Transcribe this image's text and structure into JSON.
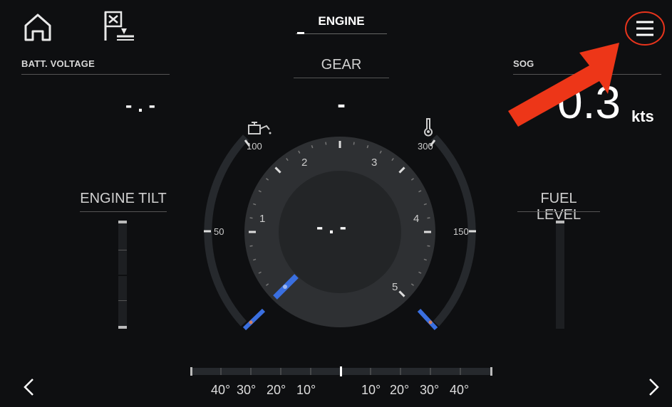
{
  "header": {
    "title": "ENGINE"
  },
  "batt_voltage": {
    "label": "BATT. VOLTAGE",
    "value": "- . -"
  },
  "gear": {
    "label": "GEAR",
    "value": "-"
  },
  "sog": {
    "label": "SOG",
    "value": "0.3",
    "unit": "kts"
  },
  "engine_tilt": {
    "label": "ENGINE TILT"
  },
  "fuel_level": {
    "label": "FUEL LEVEL"
  },
  "rpm_gauge": {
    "center_value": "- . -",
    "ticks": [
      "1",
      "2",
      "3",
      "4",
      "5"
    ]
  },
  "oil_pressure": {
    "ticks": [
      "100",
      "50"
    ]
  },
  "temperature": {
    "ticks": [
      "300",
      "150"
    ]
  },
  "trim": {
    "left_ticks": [
      "40°",
      "30°",
      "20°",
      "10°"
    ],
    "right_ticks": [
      "10°",
      "20°",
      "30°",
      "40°"
    ]
  },
  "icons": {
    "home": "home-icon",
    "waypoint": "waypoint-flag-icon",
    "menu": "menu-icon",
    "prev": "chevron-left-icon",
    "next": "chevron-right-icon",
    "oil": "oil-can-icon",
    "temp": "thermometer-icon"
  },
  "colors": {
    "background": "#0e0f11",
    "needle": "#3a6fe0",
    "annotation": "#e8341c"
  }
}
